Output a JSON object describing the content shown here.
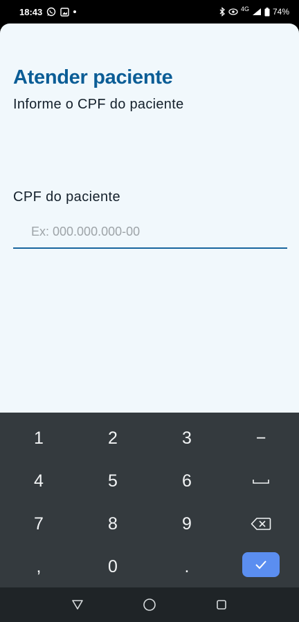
{
  "status_bar": {
    "time": "18:43",
    "network": "4G",
    "battery": "74%",
    "left_icons": [
      "whatsapp-icon",
      "gallery-icon",
      "notification-dot-icon"
    ],
    "right_icons": [
      "bluetooth-icon",
      "eye-comfort-icon",
      "signal-icon",
      "battery-icon"
    ]
  },
  "page": {
    "title": "Atender paciente",
    "subtitle": "Informe o CPF do paciente"
  },
  "cpf_field": {
    "label": "CPF do paciente",
    "value": "",
    "placeholder": "Ex: 000.000.000-00"
  },
  "keyboard": {
    "keys": [
      "1",
      "2",
      "3",
      "−",
      "4",
      "5",
      "6",
      "␣",
      "7",
      "8",
      "9",
      "backspace",
      ",",
      "0",
      ".",
      "done"
    ],
    "accent_color": "#5b8ef0"
  },
  "nav_bar": {
    "buttons": [
      "back-icon",
      "home-icon",
      "recents-icon"
    ]
  },
  "colors": {
    "title": "#0b5d96",
    "screen_background": "#f1f8fc",
    "input_underline": "#17659e",
    "keyboard_background": "#343a3e"
  }
}
